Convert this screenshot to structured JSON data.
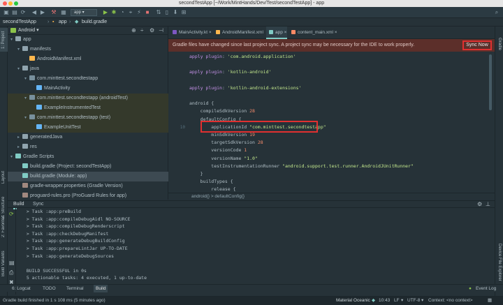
{
  "window": {
    "title": "secondTestApp [~/Work/MintHands/Dev/Test/secondTestApp] - app"
  },
  "toolbar": {
    "config": "app"
  },
  "breadcrumb": [
    "secondTestApp",
    "app",
    "build.gradle"
  ],
  "project_panel": {
    "view": "Android",
    "items": [
      {
        "label": "app",
        "depth": 0,
        "icon": "folder-icon"
      },
      {
        "label": "manifests",
        "depth": 1,
        "icon": "folder-icon"
      },
      {
        "label": "AndroidManifest.xml",
        "depth": 2,
        "icon": "manifest-icon"
      },
      {
        "label": "java",
        "depth": 1,
        "icon": "folder-icon"
      },
      {
        "label": "com.minttest.secondtestapp",
        "depth": 2,
        "icon": "package-icon"
      },
      {
        "label": "MainActivity",
        "depth": 3,
        "icon": "class-icon"
      },
      {
        "label": "com.minttest.secondtestapp (androidTest)",
        "depth": 2,
        "icon": "package-icon"
      },
      {
        "label": "ExampleInstrumentedTest",
        "depth": 3,
        "icon": "class-icon"
      },
      {
        "label": "com.minttest.secondtestapp (test)",
        "depth": 2,
        "icon": "package-icon"
      },
      {
        "label": "ExampleUnitTest",
        "depth": 3,
        "icon": "class-icon"
      },
      {
        "label": "generatedJava",
        "depth": 1,
        "icon": "folder-icon"
      },
      {
        "label": "res",
        "depth": 1,
        "icon": "folder-icon"
      },
      {
        "label": "Gradle Scripts",
        "depth": 0,
        "icon": "gradle-icon"
      },
      {
        "label": "build.gradle (Project: secondTestApp)",
        "depth": 1,
        "icon": "gradle-file-icon"
      },
      {
        "label": "build.gradle (Module: app)",
        "depth": 1,
        "icon": "gradle-file-icon"
      },
      {
        "label": "gradle-wrapper.properties (Gradle Version)",
        "depth": 1,
        "icon": "properties-icon"
      },
      {
        "label": "proguard-rules.pro (ProGuard Rules for app)",
        "depth": 1,
        "icon": "properties-icon"
      }
    ]
  },
  "editor_tabs": [
    "MainActivity.kt",
    "AndroidManifest.xml",
    "app",
    "content_main.xml"
  ],
  "notification": {
    "text": "Gradle files have changed since last project sync. A project sync may be necessary for the IDE to work properly.",
    "action": "Sync Now"
  },
  "code_lines": [
    {
      "n": "",
      "text": "apply plugin: 'com.android.application'"
    },
    {
      "n": "",
      "text": ""
    },
    {
      "n": "",
      "text": "apply plugin: 'kotlin-android'"
    },
    {
      "n": "",
      "text": ""
    },
    {
      "n": "",
      "text": "apply plugin: 'kotlin-android-extensions'"
    },
    {
      "n": "",
      "text": ""
    },
    {
      "n": "",
      "text": "android {"
    },
    {
      "n": "",
      "text": "    compileSdkVersion 28"
    },
    {
      "n": "",
      "text": "    defaultConfig {"
    },
    {
      "n": "10",
      "text": "        applicationId \"com.minttest.secondtestapp\""
    },
    {
      "n": "",
      "text": "        minSdkVersion 19"
    },
    {
      "n": "",
      "text": "        targetSdkVersion 28"
    },
    {
      "n": "",
      "text": "        versionCode 1"
    },
    {
      "n": "",
      "text": "        versionName \"1.0\""
    },
    {
      "n": "",
      "text": "        testInstrumentationRunner \"android.support.test.runner.AndroidJUnitRunner\""
    },
    {
      "n": "",
      "text": "    }"
    },
    {
      "n": "",
      "text": "    buildTypes {"
    },
    {
      "n": "",
      "text": "        release {"
    }
  ],
  "editor_breadcrumb": "android{}  >  defaultConfig{}",
  "build_tabs": [
    "Build",
    "Sync"
  ],
  "build_output": [
    "  > Task :app:preBuild",
    "  > Task :app:compileDebugAidl NO-SOURCE",
    "  > Task :app:compileDebugRenderscript",
    "  > Task :app:checkDebugManifest",
    "  > Task :app:generateDebugBuildConfig",
    "  > Task :app:prepareLintJar UP-TO-DATE",
    "  > Task :app:generateDebugSources",
    "",
    "  BUILD SUCCESSFUL in 0s",
    "  5 actionable tasks: 4 executed, 1 up-to-date"
  ],
  "tool_tabs": [
    "6: Logcat",
    "TODO",
    "Terminal",
    "Build"
  ],
  "event_log": "Event Log",
  "left_vtabs": [
    "1: Project",
    "Layout Captures",
    "Z: Structure",
    "2: Favorites",
    "Build Variants"
  ],
  "right_vtabs": [
    "Gradle",
    "Device File Explorer"
  ],
  "status": {
    "message": "Gradle build finished in 1 s 108 ms (5 minutes ago)",
    "theme": "Material Oceanic",
    "position": "10:43",
    "line_sep": "LF",
    "encoding": "UTF-8",
    "context": "Context: <no context>"
  },
  "colors": {
    "accent_red": "#e03030",
    "bg": "#263238",
    "notify_bg": "#5c2f2a"
  }
}
